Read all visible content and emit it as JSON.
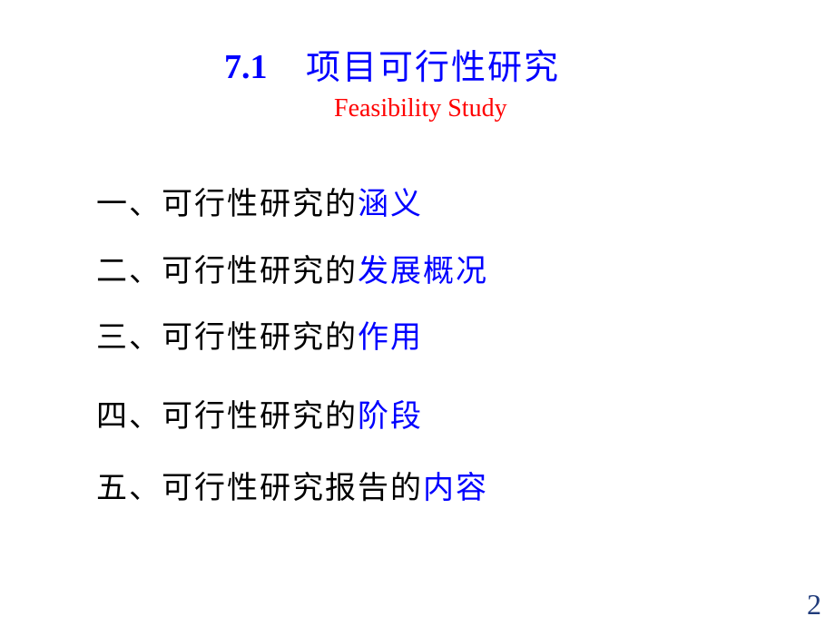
{
  "slide": {
    "title": {
      "number": "7.1",
      "text": "项目可行性研究",
      "subtitle": "Feasibility Study",
      "color": "#0000ff",
      "subtitle_color": "#ff0000"
    },
    "items": [
      {
        "prefix": "一、可行性研究的",
        "highlight": "涵义"
      },
      {
        "prefix": "二、可行性研究的",
        "highlight": "发展概况"
      },
      {
        "prefix": "三、可行性研究的",
        "highlight": "作用"
      },
      {
        "prefix": "四、可行性研究的",
        "highlight": "阶段"
      },
      {
        "prefix": "五、可行性研究报告的",
        "highlight": "内容"
      }
    ],
    "highlight_color": "#0000ff",
    "page_number": "2"
  }
}
